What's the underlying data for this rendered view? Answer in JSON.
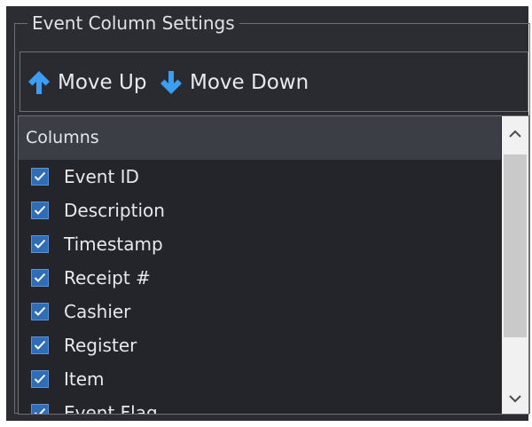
{
  "groupbox": {
    "title": "Event Column Settings"
  },
  "toolbar": {
    "move_up_label": "Move Up",
    "move_down_label": "Move Down"
  },
  "list": {
    "header": "Columns",
    "items": [
      {
        "label": "Event ID",
        "checked": true
      },
      {
        "label": "Description",
        "checked": true
      },
      {
        "label": "Timestamp",
        "checked": true
      },
      {
        "label": "Receipt #",
        "checked": true
      },
      {
        "label": "Cashier",
        "checked": true
      },
      {
        "label": "Register",
        "checked": true
      },
      {
        "label": "Item",
        "checked": true
      },
      {
        "label": "Event Flag",
        "checked": true
      }
    ]
  },
  "icons": {
    "move_up": "arrow-up-icon",
    "move_down": "arrow-down-icon",
    "checkbox": "check-icon",
    "scroll_up": "chevron-up-icon",
    "scroll_down": "chevron-down-icon"
  },
  "colors": {
    "panel_bg": "#2b2d33",
    "list_bg": "#23252b",
    "header_bg": "#3b3e45",
    "accent_arrow": "#3d9df0",
    "checkbox": "#2f6db7"
  }
}
